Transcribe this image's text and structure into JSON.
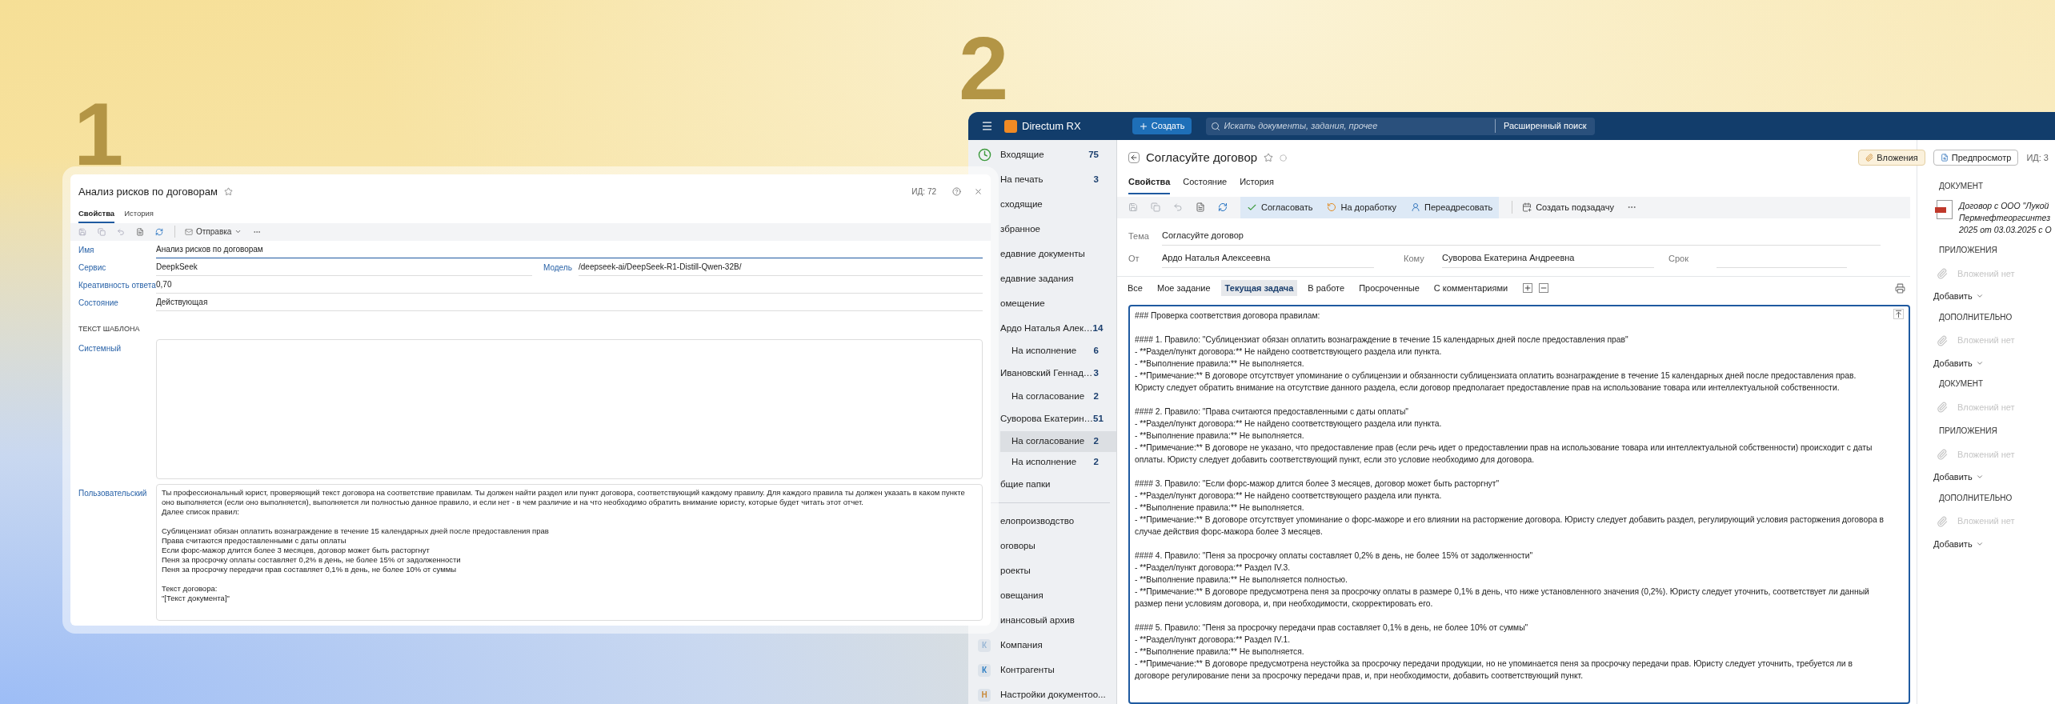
{
  "steps": [
    "1",
    "2"
  ],
  "left_window": {
    "title": "Анализ рисков по договорам",
    "id": "ИД: 72",
    "tabs": [
      {
        "label": "Свойства",
        "selected": true
      },
      {
        "label": "История",
        "selected": false
      }
    ],
    "toolbar": {
      "dropdown": "Отправка"
    },
    "fields": [
      {
        "label": "Имя",
        "value": "Анализ рисков по договорам",
        "focused": true
      },
      {
        "label": "Сервис",
        "value": "DeepkSeek",
        "focused": false,
        "extra": {
          "label": "Модель",
          "value": "/deepseek-ai/DeepSeek-R1-Distill-Qwen-32B/"
        }
      },
      {
        "label": "Креативность ответа",
        "value": "0,70",
        "focused": false
      },
      {
        "label": "Состояние",
        "value": "Действующая",
        "focused": false
      }
    ],
    "section": "ТЕКСТ ШАБЛОНА",
    "system_prompt": {
      "label": "Системный"
    },
    "user_prompt": {
      "label": "Пользовательский",
      "paragraphs": [
        [
          "Ты профессиональный юрист, проверяющий текст договора на соответствие правилам. Ты должен найти раздел или пункт договора, соответствующий каждому правилу. Для каждого правила ты должен указать в каком пункте оно выполняется (если оно выполняется), выполняется ли полностью данное правило, и если нет - в чем различие и на что необходимо обратить внимание юристу, которые будет читать этот отчет.",
          "Далее список правил:"
        ],
        [
          "Сублицензиат обязан оплатить вознаграждение в течение 15 календарных дней после предоставления прав",
          "Права считаются предоставленными с даты оплаты",
          "Если форс-мажор длится более 3 месяцев, договор может быть расторгнут",
          "Пеня за просрочку оплаты составляет 0,2% в день, не более 15% от задолженности",
          "Пеня за просрочку передачи прав составляет 0,1% в день, не более 10% от суммы"
        ],
        [
          "Текст договора:",
          "\"[Текст документа]\""
        ]
      ]
    }
  },
  "right_window": {
    "app_name": "Directum RX",
    "create": "Создать",
    "search": {
      "placeholder": "Искать документы, задания, прочее"
    },
    "advanced_search": "Расширенный поиск",
    "sidebar": {
      "items": [
        {
          "kind": "inbox",
          "label": "Входящие",
          "count": "75",
          "selected": false
        },
        {
          "kind": "item",
          "label": "На печать",
          "count": "3",
          "selected": false
        },
        {
          "kind": "item",
          "label": "сходящие",
          "selected": false
        },
        {
          "kind": "item",
          "label": "збранное",
          "selected": false
        },
        {
          "kind": "item",
          "label": "едавние документы",
          "selected": false
        },
        {
          "kind": "item",
          "label": "едавние задания",
          "selected": false
        },
        {
          "kind": "item",
          "label": "омещение",
          "selected": false
        },
        {
          "kind": "item",
          "label": "Ардо Наталья Алек…",
          "count": "14",
          "selected": false
        },
        {
          "kind": "sub",
          "label": "На исполнение",
          "count": "6",
          "selected": false
        },
        {
          "kind": "item",
          "label": "Ивановский Геннад…",
          "count": "3",
          "selected": false
        },
        {
          "kind": "sub",
          "label": "На согласование",
          "count": "2",
          "selected": false
        },
        {
          "kind": "item",
          "label": "Суворова Екатерин…",
          "count": "51",
          "selected": false
        },
        {
          "kind": "sub",
          "label": "На согласование",
          "count": "2",
          "selected": true
        },
        {
          "kind": "sub",
          "label": "На исполнение",
          "count": "2",
          "selected": false
        },
        {
          "kind": "item",
          "label": "бщие папки",
          "selected": false
        },
        {
          "kind": "divider"
        },
        {
          "kind": "item",
          "label": "елопроизводство",
          "selected": false
        },
        {
          "kind": "item",
          "label": "оговоры",
          "selected": false
        },
        {
          "kind": "item",
          "label": "роекты",
          "selected": false
        },
        {
          "kind": "item",
          "label": "овещания",
          "selected": false
        },
        {
          "kind": "item",
          "label": "инансовый архив",
          "selected": false
        },
        {
          "kind": "letter",
          "letter": "К",
          "color": "#9bb8d6",
          "label": "Компания",
          "selected": false
        },
        {
          "kind": "letter",
          "letter": "К",
          "color": "#2f7fc4",
          "label": "Контрагенты",
          "selected": false
        },
        {
          "kind": "letter",
          "letter": "Н",
          "color": "#c98a3a",
          "label": "Настройки документоо...",
          "selected": false
        }
      ]
    },
    "header": {
      "title": "Согласуйте договор",
      "buttons": [
        {
          "label": "Вложения",
          "selected": true
        },
        {
          "label": "Предпросмотр",
          "selected": false
        }
      ],
      "id": "ИД: 3"
    },
    "tabs": [
      {
        "label": "Свойства",
        "selected": true
      },
      {
        "label": "Состояние",
        "selected": false
      },
      {
        "label": "История",
        "selected": false
      }
    ],
    "actions": [
      "Согласовать",
      "На доработку",
      "Переадресовать"
    ],
    "create_subtask": "Создать подзадачу",
    "fields": {
      "subject": {
        "label": "Тема",
        "value": "Согласуйте договор"
      },
      "from": {
        "label": "От",
        "value": "Ардо Наталья Алексеевна"
      },
      "to": {
        "label": "Кому",
        "value": "Суворова Екатерина Андреевна"
      },
      "deadline": {
        "label": "Срок"
      }
    },
    "filters": [
      {
        "label": "Все",
        "selected": false
      },
      {
        "label": "Мое задание",
        "selected": false
      },
      {
        "label": "Текущая задача",
        "selected": true
      },
      {
        "label": "В работе",
        "selected": false
      },
      {
        "label": "Просроченные",
        "selected": false
      },
      {
        "label": "С комментариями",
        "selected": false
      }
    ],
    "text": [
      [
        "### Проверка соответствия договора правилам:"
      ],
      [
        "#### 1. Правило: \"Сублицензиат обязан оплатить вознаграждение в течение 15 календарных дней после предоставления прав\"",
        "- **Раздел/пункт договора:** Не найдено соответствующего раздела или пункта.",
        "- **Выполнение правила:** Не выполняется.",
        "- **Примечание:** В договоре отсутствует упоминание о сублицензии и обязанности сублицензиата оплатить вознаграждение в течение 15 календарных дней после предоставления прав. Юристу следует обратить внимание на отсутствие данного раздела, если договор предполагает предоставление прав на использование товара или интеллектуальной собственности."
      ],
      [
        "#### 2. Правило: \"Права считаются предоставленными с даты оплаты\"",
        "- **Раздел/пункт договора:** Не найдено соответствующего раздела или пункта.",
        "- **Выполнение правила:** Не выполняется.",
        "- **Примечание:** В договоре не указано, что предоставление прав (если речь идет о предоставлении прав на использование товара или интеллектуальной собственности) происходит с даты оплаты. Юристу следует добавить соответствующий пункт, если это условие необходимо для договора."
      ],
      [
        "#### 3. Правило: \"Если форс-мажор длится более 3 месяцев, договор может быть расторгнут\"",
        "- **Раздел/пункт договора:** Не найдено соответствующего раздела или пункта.",
        "- **Выполнение правила:** Не выполняется.",
        "- **Примечание:** В договоре отсутствует упоминание о форс-мажоре и его влиянии на расторжение договора. Юристу следует добавить раздел, регулирующий условия расторжения договора в случае действия форс-мажора более 3 месяцев."
      ],
      [
        "#### 4. Правило: \"Пеня за просрочку оплаты составляет 0,2% в день, не более 15% от задолженности\"",
        "- **Раздел/пункт договора:** Раздел IV.3.",
        "- **Выполнение правила:** Не выполняется полностью.",
        "- **Примечание:** В договоре предусмотрена пеня за просрочку оплаты в размере 0,1% в день, что ниже установленного значения (0,2%). Юристу следует уточнить, соответствует ли данный размер пени условиям договора, и, при необходимости, скорректировать его."
      ],
      [
        "#### 5. Правило: \"Пеня за просрочку передачи прав составляет 0,1% в день, не более 10% от суммы\"",
        "- **Раздел/пункт договора:** Раздел IV.1.",
        "- **Выполнение правила:** Не выполняется.",
        "- **Примечание:** В договоре предусмотрена неустойка за просрочку передачи продукции, но не упоминается пеня за просрочку передачи прав. Юристу следует уточнить, требуется ли в договоре регулирование пени за просрочку передачи прав, и, при необходимости, добавить соответствующий пункт."
      ]
    ],
    "attachments": [
      {
        "kind": "document",
        "title": "ДОКУМЕНТ",
        "lines": [
          "Договор с ООО \"Лукой",
          "Пермнефтеоргсинтез",
          "2025 от 03.03.2025 с О"
        ]
      },
      {
        "kind": "group",
        "title": "ПРИЛОЖЕНИЯ",
        "empty": "Вложений нет",
        "add": "Добавить"
      },
      {
        "kind": "group",
        "title": "ДОПОЛНИТЕЛЬНО",
        "empty": "Вложений нет",
        "add": "Добавить"
      },
      {
        "kind": "group",
        "title": "ДОКУМЕНТ",
        "empty": "Вложений нет"
      },
      {
        "kind": "group",
        "title": "ПРИЛОЖЕНИЯ",
        "empty": "Вложений нет",
        "add": "Добавить"
      },
      {
        "kind": "group",
        "title": "ДОПОЛНИТЕЛЬНО",
        "empty": "Вложений нет",
        "add": "Добавить"
      }
    ]
  }
}
